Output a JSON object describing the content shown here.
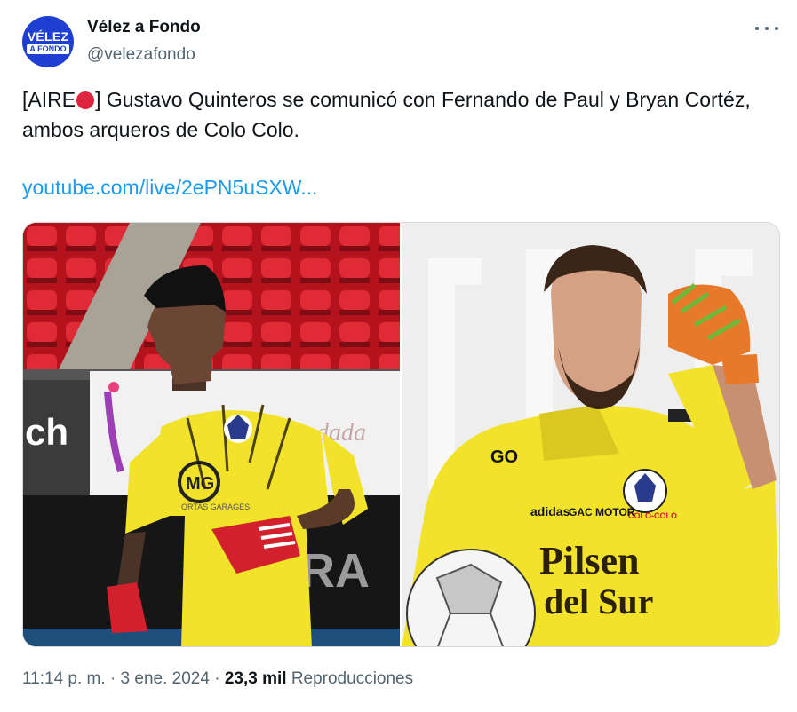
{
  "author": {
    "name": "Vélez a Fondo",
    "handle": "@velezafondo",
    "avatar_line1": "VÉLEZ",
    "avatar_line2": "A FONDO"
  },
  "tweet": {
    "text_prefix": "[AIRE",
    "text_suffix": "] Gustavo Quinteros se comunicó con Fernando de Paul y Bryan Cortéz, ambos arqueros de Colo Colo.",
    "link": "youtube.com/live/2ePN5uSXW..."
  },
  "media": {
    "left_photo": {
      "chest_logo": "MG",
      "sponsor": "ORTAS GARAGES",
      "board_text_1": "ch",
      "board_text_2": "PERA",
      "board_text_3": "dada"
    },
    "right_photo": {
      "sponsor_line1": "Pilsen",
      "sponsor_line2": "del Sur",
      "badge_text": "COLO-COLO",
      "shoulder_text": "GO",
      "kit_brand": "adidas",
      "kit_sponsor": "GAC MOTOR"
    }
  },
  "footer": {
    "time": "11:14 p. m.",
    "separator1": "·",
    "date": "3 ene. 2024",
    "separator2": "·",
    "views_count": "23,3 mil",
    "views_label": "Reproducciones"
  },
  "colors": {
    "link": "#1d9bf0",
    "secondary_text": "#536471",
    "live_dot": "#e0243e",
    "avatar_bg": "#1f3fd3",
    "jersey_yellow": "#f2e22a"
  },
  "icons": {
    "more": "more-horizontal-icon",
    "live": "red-circle-icon"
  }
}
